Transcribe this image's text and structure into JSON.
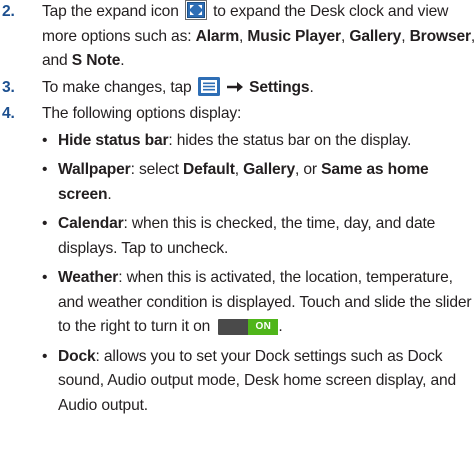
{
  "steps": [
    {
      "number": "2.",
      "text_1": "Tap the expand icon",
      "text_2": "to expand the Desk clock and view more options such as:",
      "opt_alarm": "Alarm",
      "opt_music": "Music Player",
      "opt_gallery": "Gallery",
      "opt_browser": "Browser",
      "and": "and",
      "opt_snote": "S Note",
      "end": "."
    },
    {
      "number": "3.",
      "text_1": "To make changes, tap",
      "arrow": "→",
      "settings": "Settings",
      "end": "."
    },
    {
      "number": "4.",
      "text": "The following options display:"
    }
  ],
  "bullets": {
    "hide_status": {
      "term": "Hide status bar",
      "desc": ": hides the status bar on the display."
    },
    "wallpaper": {
      "term": "Wallpaper",
      "desc_1": ": select",
      "opt_default": "Default",
      "opt_gallery": "Gallery",
      "or": "or",
      "opt_same": "Same as home screen",
      "end": "."
    },
    "calendar": {
      "term": "Calendar",
      "desc": ": when this is checked, the time, day, and date displays. Tap to uncheck."
    },
    "weather": {
      "term": "Weather",
      "desc": ": when this is activated, the location, temperature, and weather condition is displayed. Touch and slide the slider to the right to turn it on",
      "toggle_label": "ON",
      "end": "."
    },
    "dock": {
      "term": "Dock",
      "desc": ": allows you to set your Dock settings such as Dock sound, Audio output mode, Desk home screen display, and Audio output."
    }
  },
  "bullet_char": "•",
  "colors": {
    "step_number": "#1c4f8f",
    "text": "#231f20",
    "toggle_on": "#4fb51a",
    "toggle_track": "#4a4a4a",
    "icon_blue": "#2e6eb5"
  },
  "icons": [
    "expand-icon",
    "menu-icon",
    "arrow-right-icon"
  ]
}
